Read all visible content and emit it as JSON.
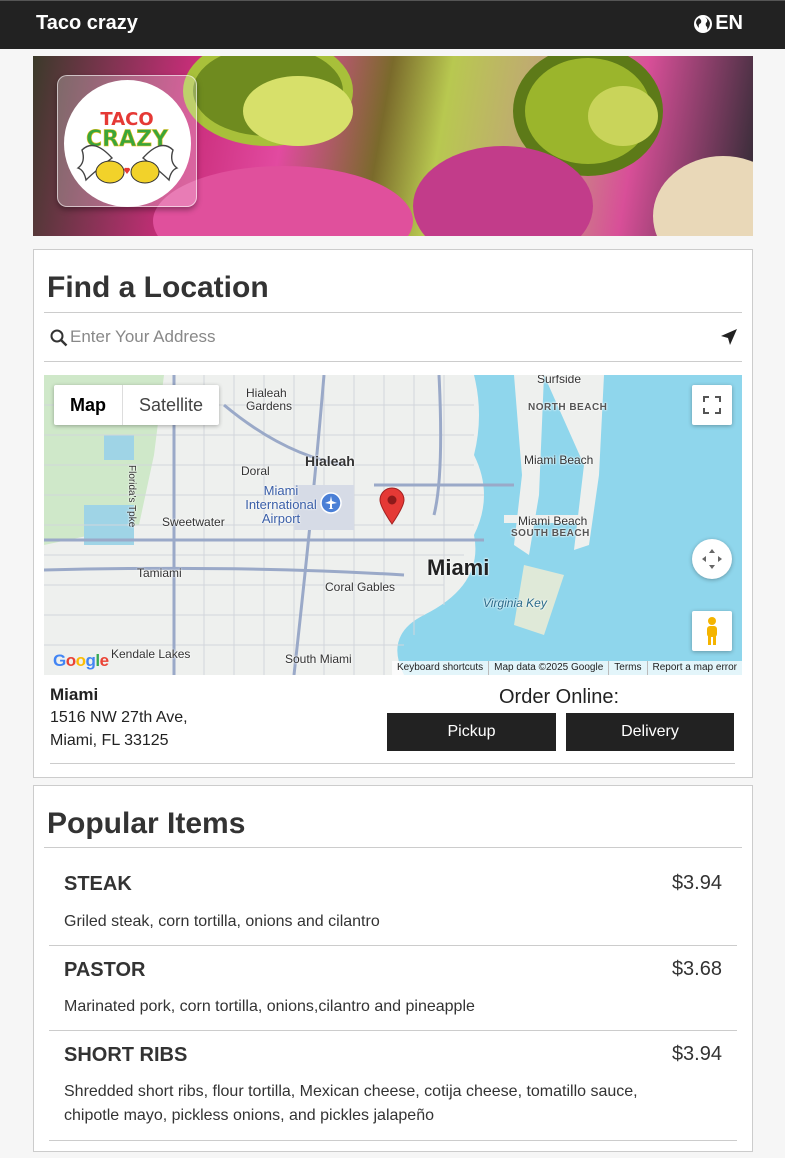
{
  "header": {
    "brand": "Taco crazy",
    "language": "EN"
  },
  "hero": {
    "logo_text": "TACO CRAZY"
  },
  "find_location": {
    "title": "Find a Location",
    "search_placeholder": "Enter Your Address",
    "map": {
      "type_controls": [
        "Map",
        "Satellite"
      ],
      "labels": {
        "miami": "Miami",
        "hialeah": "Hialeah",
        "hialeah_gardens": "Hialeah Gardens",
        "doral": "Doral",
        "miami_airport": "Miami International Airport",
        "sweetwater": "Sweetwater",
        "tamiami": "Tamiami",
        "coral_gables": "Coral Gables",
        "kendale_lakes": "Kendale Lakes",
        "south_miami": "South Miami",
        "miami_beach": "Miami Beach",
        "north_beach": "NORTH BEACH",
        "miami_beach_sb": "Miami Beach",
        "south_beach": "SOUTH BEACH",
        "virginia_key": "Virginia Key",
        "surfside": "Surfside",
        "florida_tpke": "Florida's Tpke"
      },
      "attribution": [
        "Keyboard shortcuts",
        "Map data ©2025 Google",
        "Terms",
        "Report a map error"
      ],
      "google": "Google"
    },
    "location": {
      "name": "Miami",
      "address_line1": "1516 NW 27th Ave,",
      "address_line2": "Miami, FL 33125"
    },
    "order_label": "Order Online:",
    "pickup_label": "Pickup",
    "delivery_label": "Delivery"
  },
  "popular": {
    "title": "Popular Items",
    "items": [
      {
        "name": "STEAK",
        "price": "$3.94",
        "description": "Griled steak, corn tortilla, onions and cilantro"
      },
      {
        "name": "PASTOR",
        "price": "$3.68",
        "description": "Marinated pork, corn tortilla, onions,cilantro and pineapple"
      },
      {
        "name": "SHORT RIBS",
        "price": "$3.94",
        "description": "Shredded short ribs, flour tortilla, Mexican cheese, cotija cheese, tomatillo sauce, chipotle mayo, pickless onions, and pickles jalapeño"
      }
    ]
  },
  "colors": {
    "dark": "#222222",
    "water": "#8fd6ec",
    "pin": "#e53935"
  }
}
